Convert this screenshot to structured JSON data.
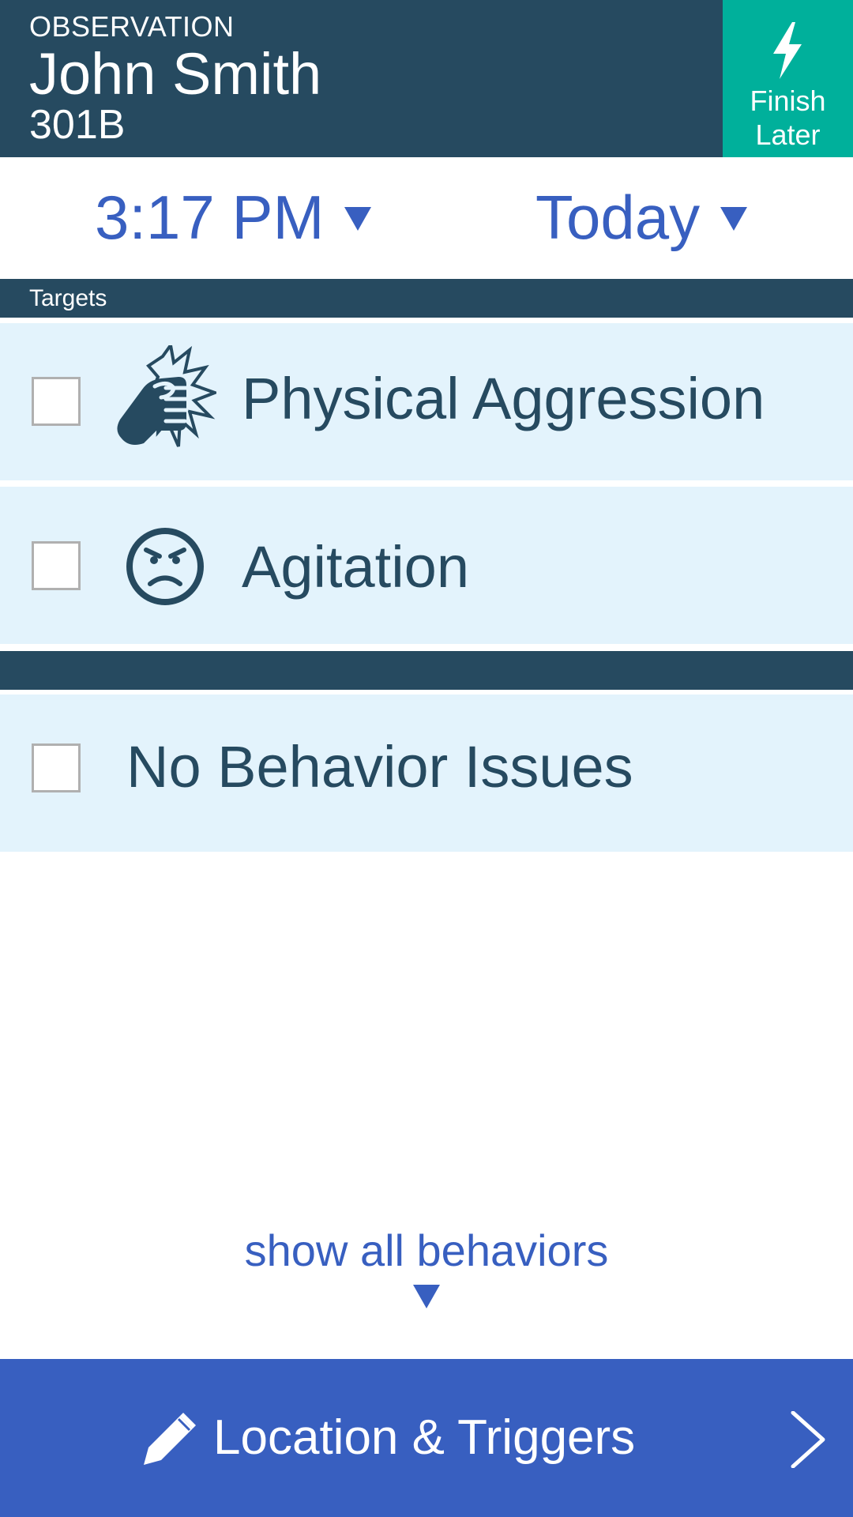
{
  "header": {
    "section_label": "OBSERVATION",
    "patient_name": "John Smith",
    "room": "301B",
    "finish_label_line1": "Finish",
    "finish_label_line2": "Later"
  },
  "pickers": {
    "time": "3:17 PM",
    "date": "Today"
  },
  "targets_section": {
    "title": "Targets"
  },
  "behaviors": [
    {
      "label": "Physical Aggression",
      "icon": "fist-impact-icon",
      "checked": false
    },
    {
      "label": "Agitation",
      "icon": "angry-face-icon",
      "checked": false
    }
  ],
  "no_issues": {
    "label": "No Behavior Issues",
    "checked": false
  },
  "show_all": {
    "label": "show all behaviors"
  },
  "bottom_bar": {
    "label": "Location & Triggers",
    "icon": "pencil-icon"
  },
  "colors": {
    "header_navy": "#264a60",
    "finish_teal": "#00b09b",
    "accent_blue": "#385fc0",
    "row_bg": "#e3f3fc"
  }
}
